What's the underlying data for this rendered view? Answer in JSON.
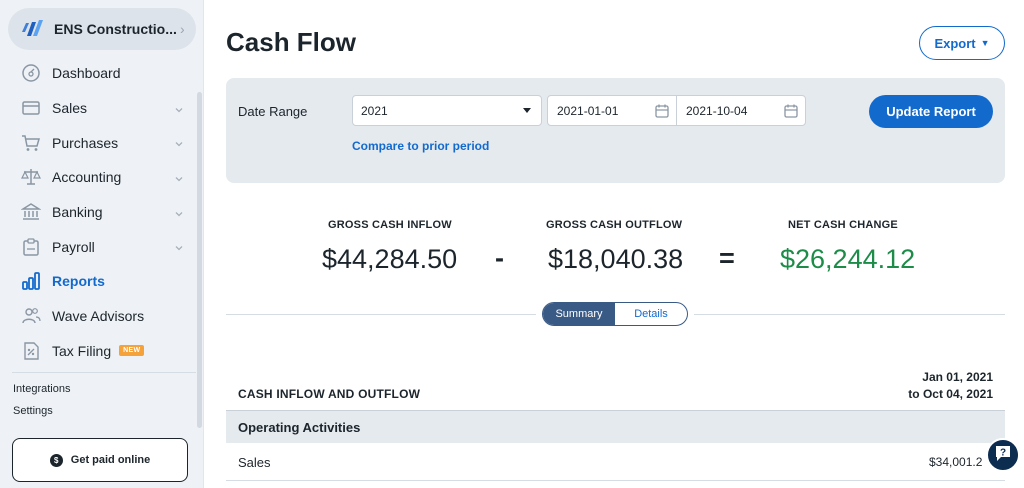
{
  "sidebar": {
    "business_name": "ENS Constructio...",
    "items": [
      {
        "label": "Dashboard",
        "icon": "dashboard-icon"
      },
      {
        "label": "Sales",
        "icon": "sales-icon"
      },
      {
        "label": "Purchases",
        "icon": "cart-icon"
      },
      {
        "label": "Accounting",
        "icon": "scales-icon"
      },
      {
        "label": "Banking",
        "icon": "bank-icon"
      },
      {
        "label": "Payroll",
        "icon": "payroll-icon"
      },
      {
        "label": "Reports",
        "icon": "bar-chart-icon",
        "active": true
      },
      {
        "label": "Wave Advisors",
        "icon": "people-icon"
      },
      {
        "label": "Tax Filing",
        "icon": "tax-icon",
        "badge": "NEW"
      }
    ],
    "integrations": "Integrations",
    "settings": "Settings",
    "get_paid": "Get paid online"
  },
  "header": {
    "title": "Cash Flow",
    "export_label": "Export"
  },
  "filters": {
    "date_range_label": "Date Range",
    "range_value": "2021",
    "start_date": "2021-01-01",
    "end_date": "2021-10-04",
    "compare_link": "Compare to prior period",
    "update_button": "Update Report"
  },
  "summary": {
    "inflow_label": "GROSS CASH INFLOW",
    "inflow_value": "$44,284.50",
    "outflow_label": "GROSS CASH OUTFLOW",
    "outflow_value": "$18,040.38",
    "net_label": "NET CASH CHANGE",
    "net_value": "$26,244.12",
    "minus": "-",
    "equals": "="
  },
  "view_toggle": {
    "summary": "Summary",
    "details": "Details",
    "selected": "Summary"
  },
  "table": {
    "heading": "CASH INFLOW AND OUTFLOW",
    "period_line1": "Jan 01, 2021",
    "period_line2": "to Oct 04, 2021",
    "section": "Operating Activities",
    "rows": [
      {
        "label": "Sales",
        "value": "$34,001.2"
      }
    ]
  },
  "colors": {
    "accent": "#136acd",
    "positive": "#1c8c48",
    "sidebar_bg": "#eef2f6"
  }
}
